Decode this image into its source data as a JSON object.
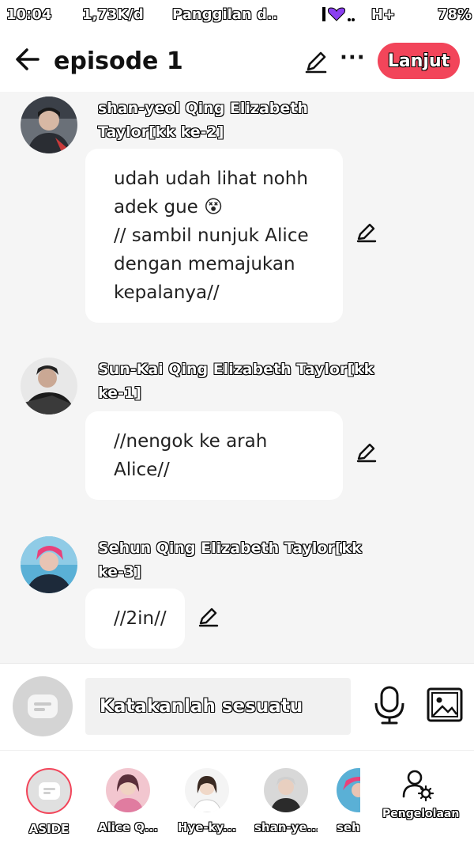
{
  "status_bar": {
    "time": "10:04",
    "speed": "1,73K/d",
    "notification": "Panggilan d..",
    "network": "H+",
    "battery": "78%"
  },
  "header": {
    "title": "episode 1",
    "more": "···",
    "continue_label": "Lanjut",
    "accent_color": "#f2455a"
  },
  "messages": [
    {
      "name": "shan-yeol Qing Elizabeth Taylor[kk ke-2]",
      "text_lines": [
        "udah udah lihat nohh",
        "adek gue 😵",
        "// sambil nunjuk Alice",
        "dengan memajukan",
        "kepalanya//"
      ]
    },
    {
      "name": "Sun-Kai Qing Elizabeth Taylor[kk ke-1]",
      "text_lines": [
        "//nengok ke arah",
        "Alice//"
      ]
    },
    {
      "name": "Sehun Qing Elizabeth Taylor[kk ke-3]",
      "text_lines": [
        "//2in//"
      ]
    }
  ],
  "input": {
    "placeholder": "Katakanlah sesuatu"
  },
  "characters": [
    {
      "label": "ASIDE"
    },
    {
      "label": "Alice Q..."
    },
    {
      "label": "Hye-ky..."
    },
    {
      "label": "shan-ye..."
    },
    {
      "label": "seh"
    }
  ],
  "manage_label": "Pengelolaan"
}
